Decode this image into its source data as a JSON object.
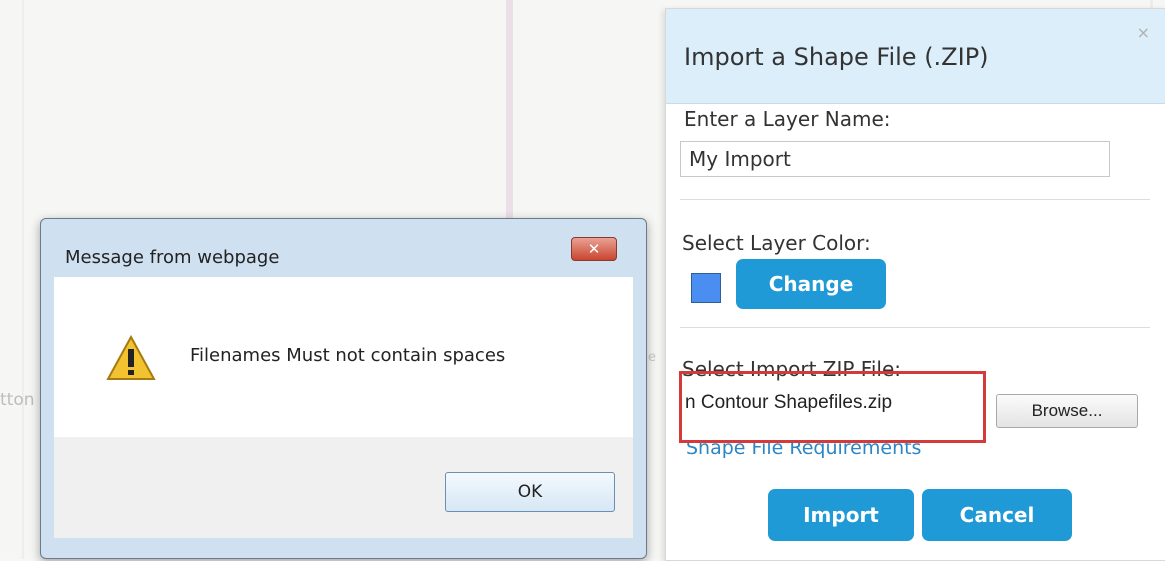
{
  "panel": {
    "title": "Import a Shape File (.ZIP)",
    "close_glyph": "×",
    "layer_name_label": "Enter a Layer Name:",
    "layer_name_value": "My Import",
    "color_label": "Select Layer Color:",
    "color_swatch": "#4b8ef2",
    "change_label": "Change",
    "zip_label": "Select Import ZIP File:",
    "file_value": "n Contour Shapefiles.zip",
    "browse_label": "Browse...",
    "requirements_link": "Shape File Requirements",
    "import_label": "Import",
    "cancel_label": "Cancel"
  },
  "dialog": {
    "title": "Message from webpage",
    "close_glyph": "✕",
    "message": "Filenames Must not contain spaces",
    "ok_label": "OK",
    "icon": "warning-icon"
  },
  "map": {
    "faint_left": "tton",
    "faint_mid": "e"
  }
}
